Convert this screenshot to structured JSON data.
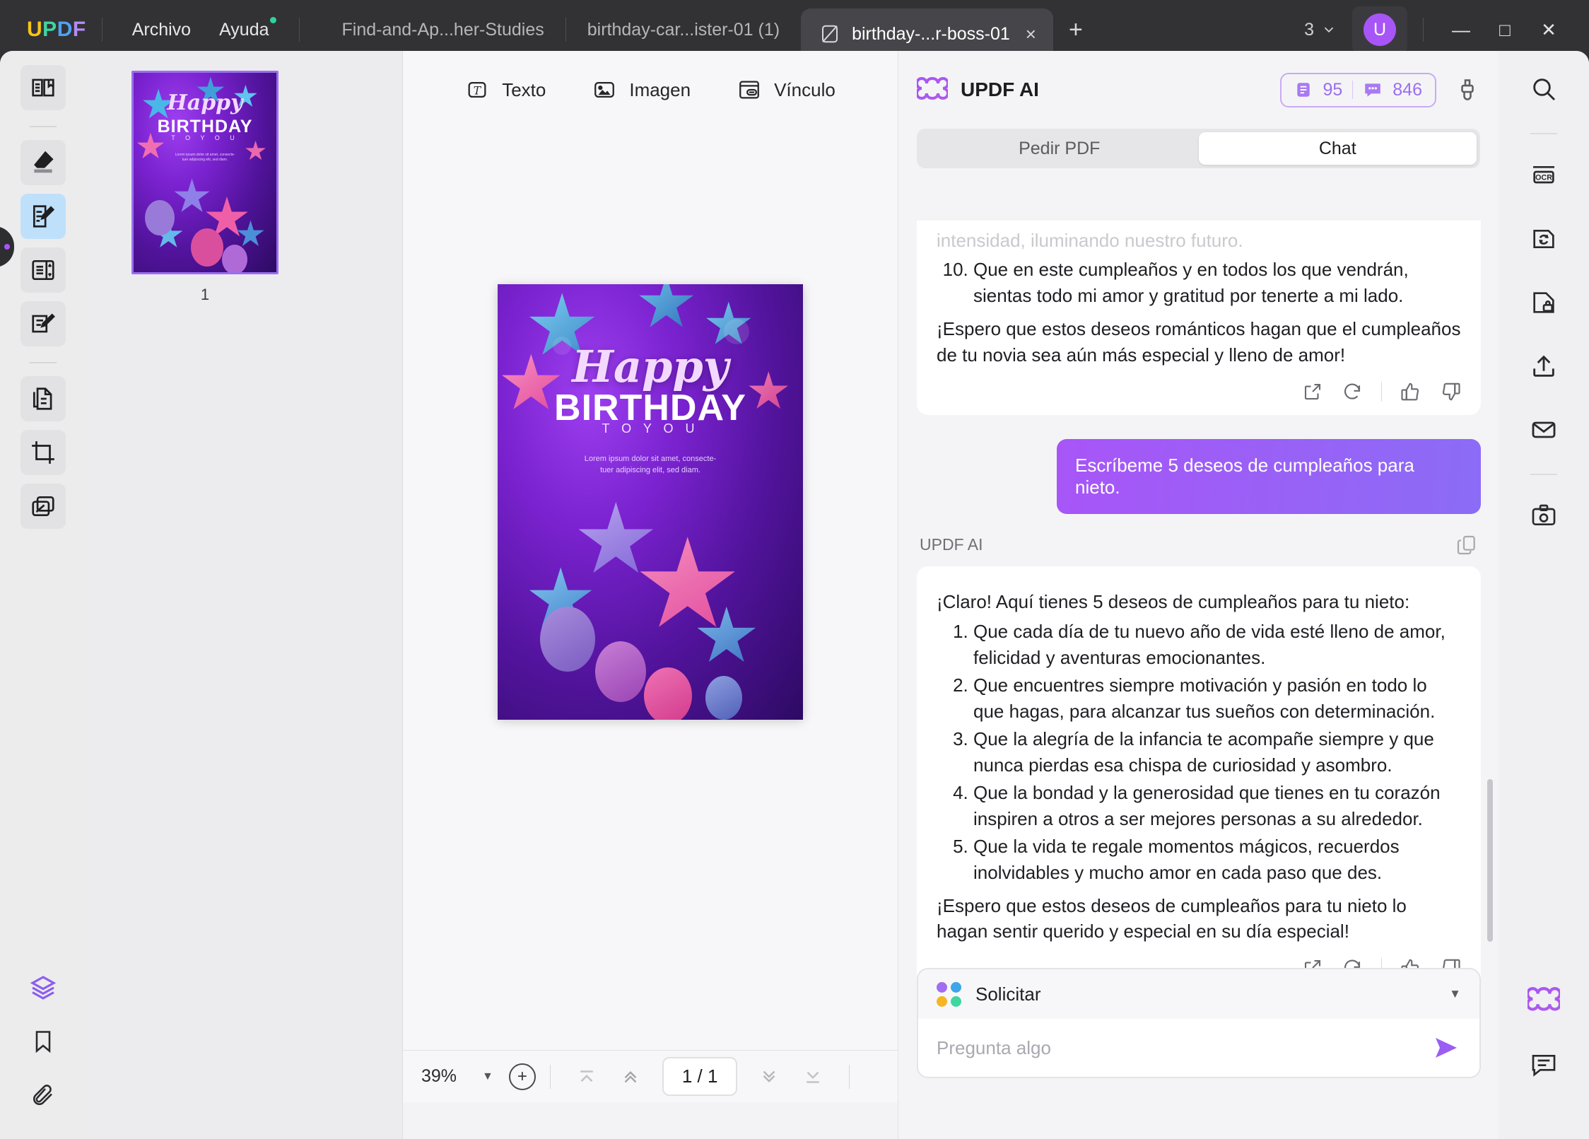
{
  "window": {
    "brand": "UPDF",
    "menus": [
      {
        "label": "Archivo",
        "badge": false
      },
      {
        "label": "Ayuda",
        "badge": true
      }
    ],
    "tabs": [
      {
        "label": "Find-and-Ap...her-Studies",
        "active": false
      },
      {
        "label": "birthday-car...ister-01 (1)",
        "active": false
      },
      {
        "label": "birthday-...r-boss-01",
        "active": true
      }
    ],
    "new_tab_label": "+",
    "close_tab_label": "×",
    "window_count": "3",
    "avatar_initial": "U",
    "controls": {
      "minimize": "—",
      "maximize": "□",
      "close": "✕"
    }
  },
  "left_rail": {
    "items": [
      {
        "name": "read-mode-icon",
        "selected": false
      },
      {
        "name": "highlighter-icon",
        "selected": false
      },
      {
        "name": "edit-pdf-icon",
        "selected": true
      },
      {
        "name": "organize-pages-icon",
        "selected": false
      },
      {
        "name": "fill-and-sign-icon",
        "selected": false
      },
      {
        "name": "convert-pdf-icon",
        "selected": false
      },
      {
        "name": "crop-page-icon",
        "selected": false
      },
      {
        "name": "batch-icon",
        "selected": false
      },
      {
        "name": "layers-icon",
        "selected": false
      },
      {
        "name": "bookmark-icon",
        "selected": false
      },
      {
        "name": "attachment-icon",
        "selected": false
      }
    ]
  },
  "thumbnails": {
    "pages": [
      {
        "number": "1",
        "selected": true
      }
    ]
  },
  "doc_toolbar": {
    "items": [
      {
        "label": "Texto",
        "icon": "text-icon"
      },
      {
        "label": "Imagen",
        "icon": "image-icon"
      },
      {
        "label": "Vínculo",
        "icon": "link-icon"
      }
    ]
  },
  "poster": {
    "happy": "Happy",
    "birthday": "BIRTHDAY",
    "to_you": "T O   Y O U",
    "lorem_line1": "Lorem ipsum dolor sit amet, consecte-",
    "lorem_line2": "tuer adipiscing elit, sed diam."
  },
  "doc_bottom": {
    "zoom": "39%",
    "zoom_caret": "▼",
    "zoom_in": "+",
    "page_indicator": "1 / 1",
    "first_page": "first-page-icon",
    "prev_page": "prev-page-icon",
    "next_page": "next-page-icon",
    "last_page": "last-page-icon"
  },
  "ai_panel": {
    "title": "UPDF AI",
    "credits": {
      "documents": "95",
      "chats": "846"
    },
    "tabs": [
      {
        "label": "Pedir PDF",
        "active": false
      },
      {
        "label": "Chat",
        "active": true
      }
    ],
    "messages": [
      {
        "role": "assistant",
        "clipped_top": "intensidad, iluminando nuestro futuro.",
        "list_start": 10,
        "list": [
          "Que en este cumpleaños y en todos los que vendrán, sientas todo mi amor y gratitud por tenerte a mi lado."
        ],
        "outro": "¡Espero que estos deseos románticos hagan que el cumpleaños de tu novia sea aún más especial y lleno de amor!"
      },
      {
        "role": "user",
        "text": "Escríbeme 5 deseos de cumpleaños para nieto."
      },
      {
        "role": "assistant",
        "label": "UPDF AI",
        "intro": "¡Claro! Aquí tienes 5 deseos de cumpleaños para tu nieto:",
        "list_start": 1,
        "list": [
          "Que cada día de tu nuevo año de vida esté lleno de amor, felicidad y aventuras emocionantes.",
          "Que encuentres siempre motivación y pasión en todo lo que hagas, para alcanzar tus sueños con determinación.",
          "Que la alegría de la infancia te acompañe siempre y que nunca pierdas esa chispa de curiosidad y asombro.",
          "Que la bondad y la generosidad que tienes en tu corazón inspiren a otros a ser mejores personas a su alrededor.",
          "Que la vida te regale momentos mágicos, recuerdos inolvidables y mucho amor en cada paso que des."
        ],
        "outro": "¡Espero que estos deseos de cumpleaños para tu nieto lo hagan sentir querido y especial en su día especial!"
      }
    ],
    "actions": {
      "export": "export-icon",
      "regenerate": "regenerate-icon",
      "thumbs_up": "thumbs-up-icon",
      "thumbs_down": "thumbs-down-icon",
      "copy": "copy-icon"
    },
    "composer": {
      "mode_label": "Solicitar",
      "mode_caret": "▼",
      "placeholder": "Pregunta algo",
      "input_value": "",
      "send": "send-icon"
    }
  },
  "right_rail": {
    "items": [
      {
        "name": "search-icon"
      },
      {
        "name": "ocr-icon"
      },
      {
        "name": "convert-icon"
      },
      {
        "name": "protect-icon"
      },
      {
        "name": "share-icon"
      },
      {
        "name": "email-icon"
      },
      {
        "name": "save-icon"
      }
    ],
    "bottom_items": [
      {
        "name": "ai-assistant-icon"
      },
      {
        "name": "comment-icon"
      }
    ]
  },
  "colors": {
    "accent": "#a855f7",
    "titlebar": "#323235",
    "panel": "#f4f4f6",
    "selected_rail": "#bfe0fb"
  }
}
